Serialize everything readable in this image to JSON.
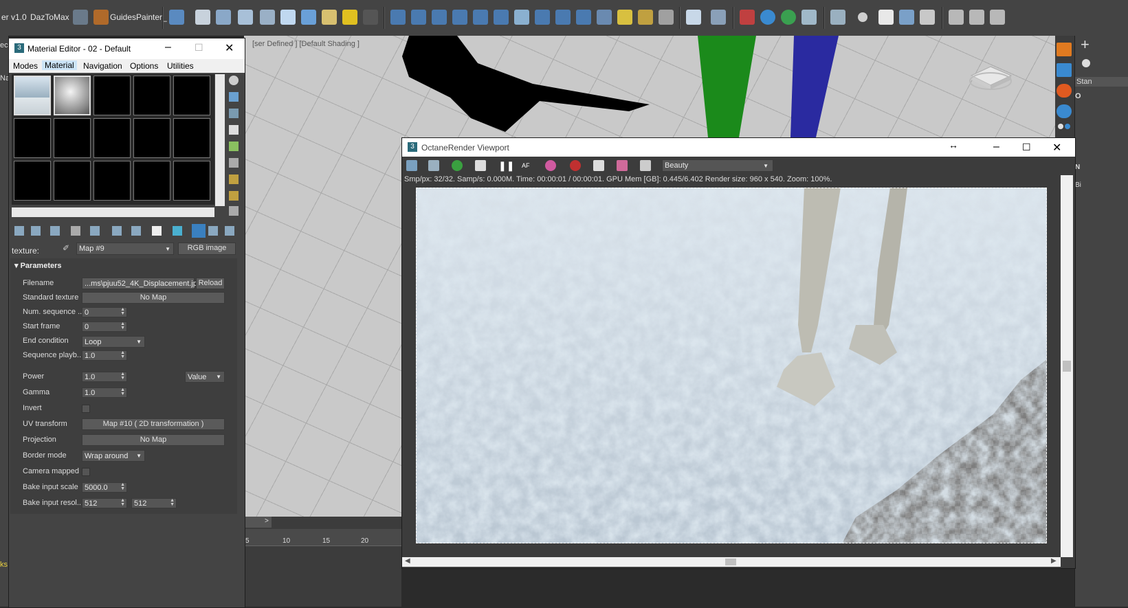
{
  "toolbar": {
    "version_label": "er v1.0",
    "daz_label": "DazToMax",
    "guides_label": "GuidesPainter_"
  },
  "viewport": {
    "label": "[ser Defined ] [Default Shading ]"
  },
  "right_panel": {
    "stan_label": "Stan",
    "n_label": "N",
    "b_label": "Bi",
    "o_label": "O"
  },
  "left_strip": {
    "top_label": "ec",
    "na_label": "Na",
    "ks_label": "ks"
  },
  "material_editor": {
    "title": "Material Editor - 02 - Default",
    "menu": [
      "Modes",
      "Material",
      "Navigation",
      "Options",
      "Utilities"
    ],
    "texture_label": "texture:",
    "map_name": "Map #9",
    "map_type": "RGB image",
    "section_title": "Parameters",
    "params": {
      "filename_label": "Filename",
      "filename_value": "...ms\\pjuu52_4K_Displacement.jpg",
      "reload_label": "Reload",
      "standard_texture_label": "Standard texture",
      "standard_texture_value": "No Map",
      "num_sequence_label": "Num. sequence ...",
      "num_sequence_value": "0",
      "start_frame_label": "Start frame",
      "start_frame_value": "0",
      "end_condition_label": "End condition",
      "end_condition_value": "Loop",
      "sequence_playback_label": "Sequence playb...",
      "sequence_playback_value": "1.0",
      "power_label": "Power",
      "power_value": "1.0",
      "power_mode": "Value",
      "gamma_label": "Gamma",
      "gamma_value": "1.0",
      "invert_label": "Invert",
      "uv_transform_label": "UV transform",
      "uv_transform_value": "Map #10 ( 2D transformation )",
      "projection_label": "Projection",
      "projection_value": "No Map",
      "border_mode_label": "Border mode",
      "border_mode_value": "Wrap around",
      "camera_mapped_label": "Camera mapped",
      "bake_scale_label": "Bake input scale",
      "bake_scale_value": "5000.0",
      "bake_res_label": "Bake input resol...",
      "bake_res_x": "512",
      "bake_res_y": "512"
    }
  },
  "octane": {
    "title": "OctaneRender Viewport",
    "render_pass": "Beauty",
    "status": "Smp/px: 32/32.   Samp/s: 0.000M.   Time: 00:00:01 / 00:00:01.   GPU Mem [GB]: 0.445/6.402   Render size: 960 x 540.   Zoom: 100%."
  },
  "timeline": {
    "ticks": [
      "5",
      "10",
      "15",
      "20"
    ]
  }
}
